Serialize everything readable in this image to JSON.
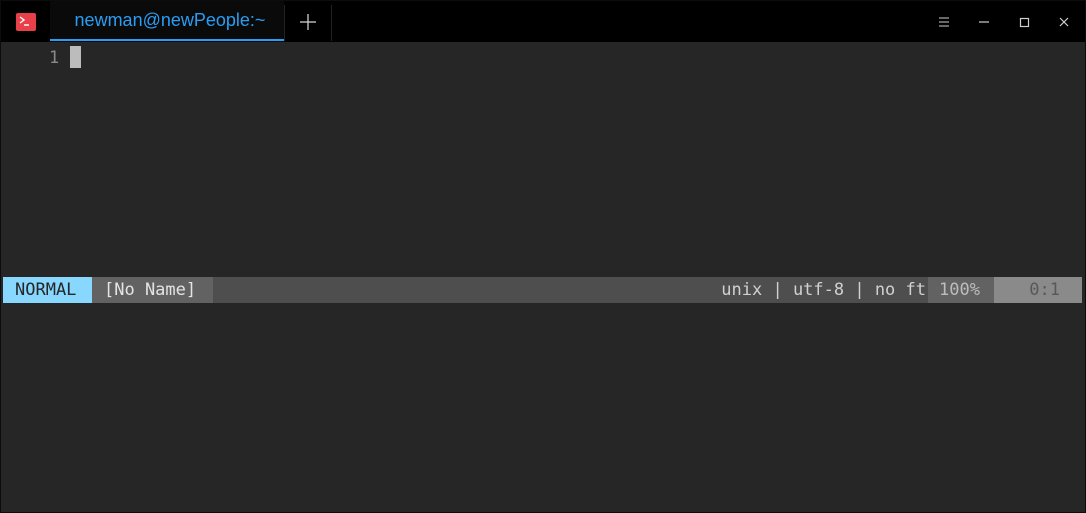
{
  "tab": {
    "title": "newman@newPeople:~",
    "new_tab_icon": "plus-icon"
  },
  "window_controls": {
    "menu_icon": "hamburger-icon",
    "minimize_icon": "minimize-icon",
    "maximize_icon": "maximize-icon",
    "close_icon": "close-icon"
  },
  "colors": {
    "accent": "#2a9df4",
    "app_icon": "#e8404a",
    "mode_bg": "#87d7ff"
  },
  "editor": {
    "line_number": "1"
  },
  "statusline": {
    "mode": "NORMAL",
    "filename": "[No Name]",
    "fileinfo": "unix | utf-8 | no ft",
    "percent": "100%",
    "position": "0:1"
  }
}
